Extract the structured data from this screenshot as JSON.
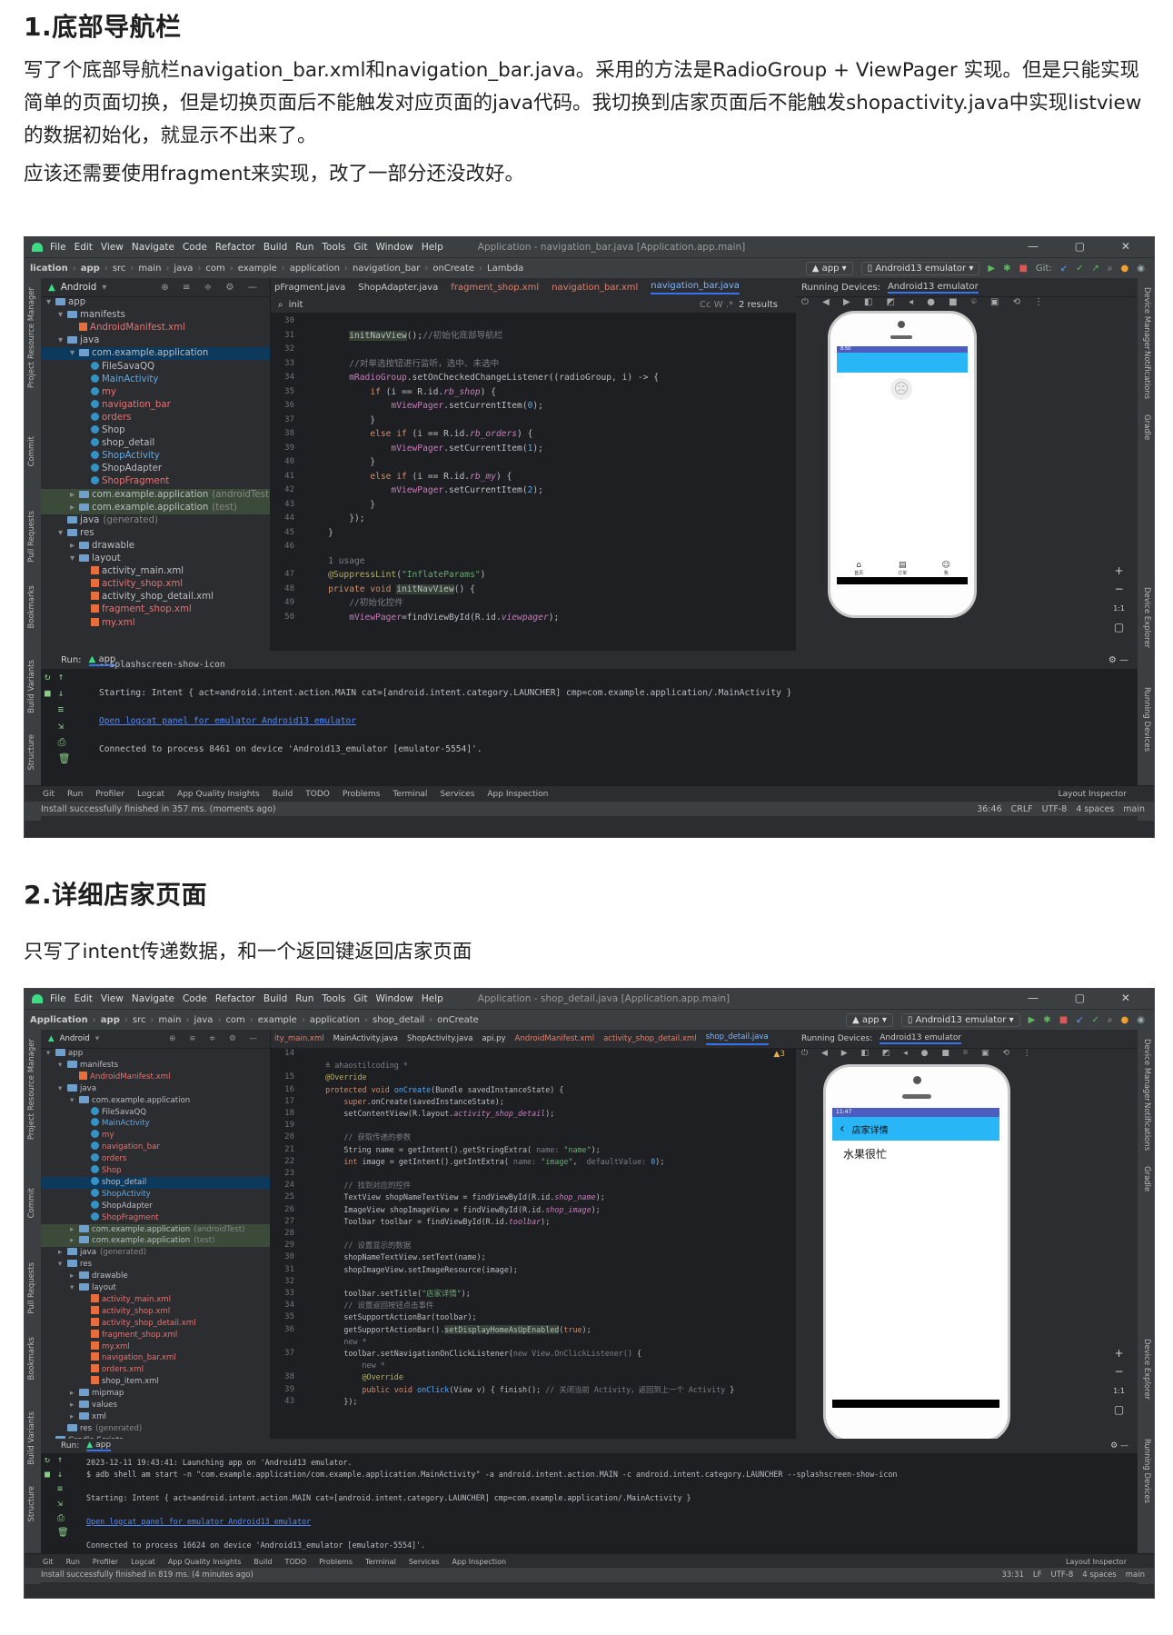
{
  "section1": {
    "heading": "1.底部导航栏",
    "para1": " 写了个底部导航栏navigation_bar.xml和navigation_bar.java。采用的方法是RadioGroup + ViewPager 实现。但是只能实现简单的页面切换，但是切换页面后不能触发对应页面的java代码。我切换到店家页面后不能触发shopactivity.java中实现listview的数据初始化，就显示不出来了。",
    "para2": "应该还需要使用fragment来实现，改了一部分还没改好。"
  },
  "ide1": {
    "menu": [
      "File",
      "Edit",
      "View",
      "Navigate",
      "Code",
      "Refactor",
      "Build",
      "Run",
      "Tools",
      "Git",
      "Window",
      "Help"
    ],
    "title": "Application - navigation_bar.java [Application.app.main]",
    "breadcrumb": [
      "lication",
      "app",
      "src",
      "main",
      "java",
      "com",
      "example",
      "application",
      "navigation_bar",
      "onCreate",
      "Lambda"
    ],
    "run_config": "app",
    "device": "Android13 emulator",
    "git_label": "Git:",
    "project_view": "Android",
    "tabs": [
      "pFragment.java",
      "ShopAdapter.java",
      "fragment_shop.xml",
      "navigation_bar.xml",
      "navigation_bar.java"
    ],
    "search_text": "init",
    "search_results": "2 results",
    "running_devices": "Running Devices:",
    "tree": [
      {
        "label": "app",
        "indent": 0,
        "type": "folder",
        "arrow": "▾"
      },
      {
        "label": "manifests",
        "indent": 1,
        "type": "folder",
        "arrow": "▾"
      },
      {
        "label": "AndroidManifest.xml",
        "indent": 2,
        "type": "xml",
        "color": "red"
      },
      {
        "label": "java",
        "indent": 1,
        "type": "folder",
        "arrow": "▾"
      },
      {
        "label": "com.example.application",
        "indent": 2,
        "type": "folder",
        "arrow": "▾",
        "sel": true
      },
      {
        "label": "FileSavaQQ",
        "indent": 3,
        "type": "class",
        "color": "normal"
      },
      {
        "label": "MainActivity",
        "indent": 3,
        "type": "class",
        "color": "blue"
      },
      {
        "label": "my",
        "indent": 3,
        "type": "class",
        "color": "red"
      },
      {
        "label": "navigation_bar",
        "indent": 3,
        "type": "class",
        "color": "red"
      },
      {
        "label": "orders",
        "indent": 3,
        "type": "class",
        "color": "red"
      },
      {
        "label": "Shop",
        "indent": 3,
        "type": "class",
        "color": "normal"
      },
      {
        "label": "shop_detail",
        "indent": 3,
        "type": "class",
        "color": "normal"
      },
      {
        "label": "ShopActivity",
        "indent": 3,
        "type": "class",
        "color": "blue"
      },
      {
        "label": "ShopAdapter",
        "indent": 3,
        "type": "class",
        "color": "normal"
      },
      {
        "label": "ShopFragment",
        "indent": 3,
        "type": "class",
        "color": "red"
      },
      {
        "label": "com.example.application",
        "suffix": "(androidTest)",
        "indent": 2,
        "type": "folder",
        "arrow": "▸",
        "hl": true
      },
      {
        "label": "com.example.application",
        "suffix": "(test)",
        "indent": 2,
        "type": "folder",
        "arrow": "▸",
        "hl": true
      },
      {
        "label": "java",
        "suffix": "(generated)",
        "indent": 1,
        "type": "folder",
        "arrow": ""
      },
      {
        "label": "res",
        "indent": 1,
        "type": "folder",
        "arrow": "▾"
      },
      {
        "label": "drawable",
        "indent": 2,
        "type": "folder",
        "arrow": "▸"
      },
      {
        "label": "layout",
        "indent": 2,
        "type": "folder",
        "arrow": "▾"
      },
      {
        "label": "activity_main.xml",
        "indent": 3,
        "type": "xml",
        "color": "normal"
      },
      {
        "label": "activity_shop.xml",
        "indent": 3,
        "type": "xml",
        "color": "red"
      },
      {
        "label": "activity_shop_detail.xml",
        "indent": 3,
        "type": "xml",
        "color": "normal"
      },
      {
        "label": "fragment_shop.xml",
        "indent": 3,
        "type": "xml",
        "color": "red"
      },
      {
        "label": "my.xml",
        "indent": 3,
        "type": "xml",
        "color": "red"
      }
    ],
    "lines": [
      {
        "n": "30",
        "h": ""
      },
      {
        "n": "31",
        "h": "        <span class='hlw'>initNavView</span>();<span class='c'>//初始化底部导航栏</span>"
      },
      {
        "n": "32",
        "h": ""
      },
      {
        "n": "33",
        "h": "        <span class='c'>//对单选按钮进行监听，选中、未选中</span>"
      },
      {
        "n": "34",
        "h": "        <span class='v'>mRadioGroup</span>.setOnCheckedChangeListener((radioGroup, i) -> {"
      },
      {
        "n": "35",
        "h": "            <span class='k'>if</span> (i == R.id.<span class='i'>rb_shop</span>) {"
      },
      {
        "n": "36",
        "h": "                <span class='v'>mViewPager</span>.setCurrentItem(<span class='f'>0</span>);"
      },
      {
        "n": "37",
        "h": "            }"
      },
      {
        "n": "38",
        "h": "            <span class='k'>else if</span> (i == R.id.<span class='i'>rb_orders</span>) {"
      },
      {
        "n": "39",
        "h": "                <span class='v'>mViewPager</span>.setCurrentItem(<span class='f'>1</span>);"
      },
      {
        "n": "40",
        "h": "            }"
      },
      {
        "n": "41",
        "h": "            <span class='k'>else if</span> (i == R.id.<span class='i'>rb_my</span>) {"
      },
      {
        "n": "42",
        "h": "                <span class='v'>mViewPager</span>.setCurrentItem(<span class='f'>2</span>);"
      },
      {
        "n": "43",
        "h": "            }"
      },
      {
        "n": "44",
        "h": "        });"
      },
      {
        "n": "45",
        "h": "    }"
      },
      {
        "n": "46",
        "h": ""
      },
      {
        "n": "",
        "h": "    <span class='c'>1 usage</span>"
      },
      {
        "n": "47",
        "h": "    <span class='a'>@SuppressLint</span>(<span class='s'>\"InflateParams\"</span>)"
      },
      {
        "n": "48",
        "h": "    <span class='k'>private void</span> <span class='hlw'>initNavView</span>() {"
      },
      {
        "n": "49",
        "h": "        <span class='c'>//初始化控件</span>"
      },
      {
        "n": "50",
        "h": "        <span class='v'>mViewPager</span>=findViewById(R.id.<span class='i'>viewpager</span>);"
      }
    ],
    "phone_nav": [
      "首页",
      "订单",
      "我"
    ],
    "phone_status": "8:50",
    "run_label": "Run:",
    "run_lines": [
      "--splashscreen-show-icon",
      "",
      "Starting: Intent { act=android.intent.action.MAIN cat=[android.intent.category.LAUNCHER] cmp=com.example.application/.MainActivity }",
      "",
      "",
      "Connected to process 8461 on device 'Android13_emulator [emulator-5554]'."
    ],
    "run_link": "Open logcat panel for emulator Android13 emulator",
    "bottom_tools": [
      "Git",
      "Run",
      "Profiler",
      "Logcat",
      "App Quality Insights",
      "Build",
      "TODO",
      "Problems",
      "Terminal",
      "Services",
      "App Inspection"
    ],
    "layout_inspector": "Layout Inspector",
    "status_left": "Install successfully finished in 357 ms. (moments ago)",
    "status_right": [
      "36:46",
      "CRLF",
      "UTF-8",
      "4 spaces",
      "main"
    ],
    "left_strip": [
      "Resource Manager",
      "Project",
      "Commit",
      "Pull Requests",
      "Bookmarks",
      "Build Variants",
      "Structure"
    ],
    "right_strip": [
      "Device Manager",
      "Notifications",
      "Gradle",
      "Device Explorer",
      "Running Devices"
    ]
  },
  "section2": {
    "heading": "2.详细店家页面",
    "para": " 只写了intent传递数据，和一个返回键返回店家页面"
  },
  "ide2": {
    "menu": [
      "File",
      "Edit",
      "View",
      "Navigate",
      "Code",
      "Refactor",
      "Build",
      "Run",
      "Tools",
      "Git",
      "Window",
      "Help"
    ],
    "title": "Application - shop_detail.java [Application.app.main]",
    "breadcrumb": [
      "Application",
      "app",
      "src",
      "main",
      "java",
      "com",
      "example",
      "application",
      "shop_detail",
      "onCreate"
    ],
    "run_config": "app",
    "device": "Android13 emulator",
    "project_view": "Android",
    "tabs": [
      "ity_main.xml",
      "MainActivity.java",
      "ShopActivity.java",
      "api.py",
      "AndroidManifest.xml",
      "activity_shop_detail.xml",
      "shop_detail.java"
    ],
    "warn": "▲3",
    "running_devices": "Running Devices:",
    "tree": [
      {
        "label": "app",
        "indent": 0,
        "type": "folder",
        "arrow": "▾"
      },
      {
        "label": "manifests",
        "indent": 1,
        "type": "folder",
        "arrow": "▾"
      },
      {
        "label": "AndroidManifest.xml",
        "indent": 2,
        "type": "xml",
        "color": "red"
      },
      {
        "label": "java",
        "indent": 1,
        "type": "folder",
        "arrow": "▾"
      },
      {
        "label": "com.example.application",
        "indent": 2,
        "type": "folder",
        "arrow": "▾"
      },
      {
        "label": "FileSavaQQ",
        "indent": 3,
        "type": "class",
        "color": "normal"
      },
      {
        "label": "MainActivity",
        "indent": 3,
        "type": "class",
        "color": "blue"
      },
      {
        "label": "my",
        "indent": 3,
        "type": "class",
        "color": "red"
      },
      {
        "label": "navigation_bar",
        "indent": 3,
        "type": "class",
        "color": "red"
      },
      {
        "label": "orders",
        "indent": 3,
        "type": "class",
        "color": "red"
      },
      {
        "label": "Shop",
        "indent": 3,
        "type": "class",
        "color": "red"
      },
      {
        "label": "shop_detail",
        "indent": 3,
        "type": "class",
        "color": "normal",
        "sel": true
      },
      {
        "label": "ShopActivity",
        "indent": 3,
        "type": "class",
        "color": "blue"
      },
      {
        "label": "ShopAdapter",
        "indent": 3,
        "type": "class",
        "color": "normal"
      },
      {
        "label": "ShopFragment",
        "indent": 3,
        "type": "class",
        "color": "red"
      },
      {
        "label": "com.example.application",
        "suffix": "(androidTest)",
        "indent": 2,
        "type": "folder",
        "arrow": "▸",
        "hl": true
      },
      {
        "label": "com.example.application",
        "suffix": "(test)",
        "indent": 2,
        "type": "folder",
        "arrow": "▸",
        "hl": true
      },
      {
        "label": "java",
        "suffix": "(generated)",
        "indent": 1,
        "type": "folder",
        "arrow": "▸"
      },
      {
        "label": "res",
        "indent": 1,
        "type": "folder",
        "arrow": "▾"
      },
      {
        "label": "drawable",
        "indent": 2,
        "type": "folder",
        "arrow": "▸"
      },
      {
        "label": "layout",
        "indent": 2,
        "type": "folder",
        "arrow": "▾"
      },
      {
        "label": "activity_main.xml",
        "indent": 3,
        "type": "xml",
        "color": "red"
      },
      {
        "label": "activity_shop.xml",
        "indent": 3,
        "type": "xml",
        "color": "red"
      },
      {
        "label": "activity_shop_detail.xml",
        "indent": 3,
        "type": "xml",
        "color": "red"
      },
      {
        "label": "fragment_shop.xml",
        "indent": 3,
        "type": "xml",
        "color": "red"
      },
      {
        "label": "my.xml",
        "indent": 3,
        "type": "xml",
        "color": "red"
      },
      {
        "label": "navigation_bar.xml",
        "indent": 3,
        "type": "xml",
        "color": "red"
      },
      {
        "label": "orders.xml",
        "indent": 3,
        "type": "xml",
        "color": "red"
      },
      {
        "label": "shop_item.xml",
        "indent": 3,
        "type": "xml",
        "color": "normal"
      },
      {
        "label": "mipmap",
        "indent": 2,
        "type": "folder",
        "arrow": "▸"
      },
      {
        "label": "values",
        "indent": 2,
        "type": "folder",
        "arrow": "▸"
      },
      {
        "label": "xml",
        "indent": 2,
        "type": "folder",
        "arrow": "▸"
      },
      {
        "label": "res",
        "suffix": "(generated)",
        "indent": 1,
        "type": "folder",
        "arrow": ""
      },
      {
        "label": "Gradle Scripts",
        "indent": 0,
        "type": "folder",
        "arrow": "▸"
      }
    ],
    "lines": [
      {
        "n": "14",
        "h": ""
      },
      {
        "n": "",
        "h": "    <span class='c'>≗ ahaostilcoding *</span>"
      },
      {
        "n": "15",
        "h": "    <span class='a'>@Override</span>"
      },
      {
        "n": "16",
        "h": "    <span class='k'>protected void</span> <span class='f'>onCreate</span>(Bundle savedInstanceState) {"
      },
      {
        "n": "17",
        "h": "        <span class='k'>super</span>.onCreate(savedInstanceState);"
      },
      {
        "n": "18",
        "h": "        setContentView(R.layout.<span class='i'>activity_shop_detail</span>);"
      },
      {
        "n": "19",
        "h": ""
      },
      {
        "n": "20",
        "h": "        <span class='c'>// 获取传递的参数</span>"
      },
      {
        "n": "21",
        "h": "        String name = getIntent().getStringExtra( <span class='c'>name:</span> <span class='s'>\"name\"</span>);"
      },
      {
        "n": "22",
        "h": "        <span class='k'>int</span> image = getIntent().getIntExtra( <span class='c'>name:</span> <span class='s'>\"image\"</span>,  <span class='c'>defaultValue:</span> <span class='f'>0</span>);"
      },
      {
        "n": "23",
        "h": ""
      },
      {
        "n": "24",
        "h": "        <span class='c'>// 找到对应的控件</span>"
      },
      {
        "n": "25",
        "h": "        TextView shopNameTextView = findViewById(R.id.<span class='i'>shop_name</span>);"
      },
      {
        "n": "26",
        "h": "        ImageView shopImageView = findViewById(R.id.<span class='i'>shop_image</span>);"
      },
      {
        "n": "27",
        "h": "        Toolbar toolbar = findViewById(R.id.<span class='i'>toolbar</span>);"
      },
      {
        "n": "28",
        "h": ""
      },
      {
        "n": "29",
        "h": "        <span class='c'>// 设置显示的数据</span>"
      },
      {
        "n": "30",
        "h": "        shopNameTextView.setText(name);"
      },
      {
        "n": "31",
        "h": "        shopImageView.setImageResource(image);"
      },
      {
        "n": "32",
        "h": ""
      },
      {
        "n": "33",
        "h": "        toolbar.setTitle(<span class='s'>\"店家详情\"</span>);"
      },
      {
        "n": "34",
        "h": "        <span class='c'>// 设置返回按钮点击事件</span>"
      },
      {
        "n": "35",
        "h": "        setSupportActionBar(toolbar);"
      },
      {
        "n": "36",
        "h": "        getSupportActionBar().<span class='hlw'>setDisplayHomeAsUpEnabled</span>(<span class='k'>true</span>);"
      },
      {
        "n": "",
        "h": "        <span class='c'>new *</span>"
      },
      {
        "n": "37",
        "h": "        toolbar.setNavigationOnClickListener(<span class='c'>new View.OnClickListener()</span> {"
      },
      {
        "n": "",
        "h": "            <span class='c'>new *</span>"
      },
      {
        "n": "38",
        "h": "            <span class='a'>@Override</span>"
      },
      {
        "n": "39",
        "h": "            <span class='k'>public void</span> <span class='f'>onClick</span>(View v) { finish(); <span class='c'>// 关闭当前 Activity，返回到上一个 Activity</span> }"
      },
      {
        "n": "43",
        "h": "        });"
      }
    ],
    "phone_status": "11:47",
    "phone_toolbar": "店家详情",
    "phone_back": "‹",
    "phone_body": "水果很忙",
    "run_label": "Run:",
    "run_lines": [
      "2023-12-11 19:43:41: Launching app on 'Android13 emulator.",
      "$ adb shell am start -n \"com.example.application/com.example.application.MainActivity\" -a android.intent.action.MAIN -c android.intent.category.LAUNCHER --splashscreen-show-icon",
      "",
      "Starting: Intent { act=android.intent.action.MAIN cat=[android.intent.category.LAUNCHER] cmp=com.example.application/.MainActivity }",
      "",
      "",
      "Connected to process 16624 on device 'Android13_emulator [emulator-5554]'."
    ],
    "run_link": "Open logcat panel for emulator Android13 emulator",
    "bottom_tools": [
      "Git",
      "Run",
      "Profiler",
      "Logcat",
      "App Quality Insights",
      "Build",
      "TODO",
      "Problems",
      "Terminal",
      "Services",
      "App Inspection"
    ],
    "layout_inspector": "Layout Inspector",
    "status_left": "Install successfully finished in 819 ms. (4 minutes ago)",
    "status_right": [
      "33:31",
      "LF",
      "UTF-8",
      "4 spaces",
      "main"
    ],
    "left_strip": [
      "Resource Manager",
      "Project",
      "Commit",
      "Pull Requests",
      "Bookmarks",
      "Build Variants",
      "Structure"
    ],
    "right_strip": [
      "Device Manager",
      "Notifications",
      "Gradle",
      "Device Explorer",
      "Running Devices"
    ]
  }
}
